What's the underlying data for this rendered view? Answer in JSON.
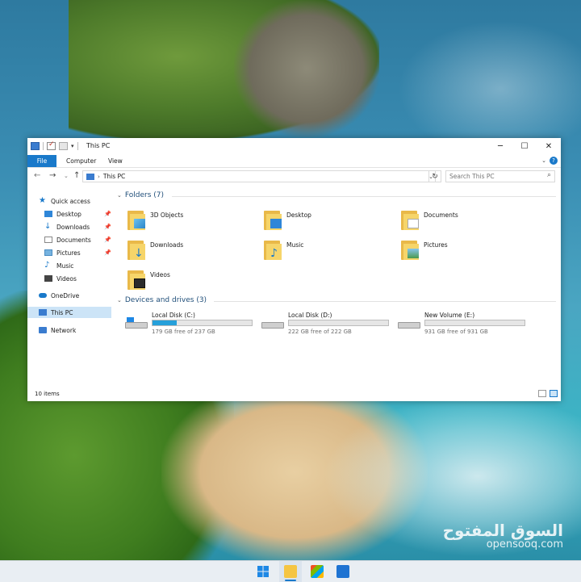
{
  "window": {
    "title": "This PC",
    "ribbon_tabs": [
      "File",
      "Computer",
      "View"
    ],
    "address_path": "This PC",
    "search_placeholder": "Search This PC"
  },
  "sidebar": {
    "items": [
      {
        "label": "Quick access",
        "icon": "star-icon"
      },
      {
        "label": "Desktop",
        "icon": "desktop-icon",
        "pinned": true
      },
      {
        "label": "Downloads",
        "icon": "download-icon",
        "pinned": true
      },
      {
        "label": "Documents",
        "icon": "documents-icon",
        "pinned": true
      },
      {
        "label": "Pictures",
        "icon": "pictures-icon",
        "pinned": true
      },
      {
        "label": "Music",
        "icon": "music-icon"
      },
      {
        "label": "Videos",
        "icon": "videos-icon"
      },
      {
        "label": "OneDrive",
        "icon": "cloud-icon"
      },
      {
        "label": "This PC",
        "icon": "computer-icon",
        "selected": true
      },
      {
        "label": "Network",
        "icon": "network-icon"
      }
    ]
  },
  "folders_section": {
    "title": "Folders (7)",
    "items": [
      {
        "label": "3D Objects",
        "icon": "3d-objects-folder-icon"
      },
      {
        "label": "Desktop",
        "icon": "desktop-folder-icon"
      },
      {
        "label": "Documents",
        "icon": "documents-folder-icon"
      },
      {
        "label": "Downloads",
        "icon": "downloads-folder-icon"
      },
      {
        "label": "Music",
        "icon": "music-folder-icon"
      },
      {
        "label": "Pictures",
        "icon": "pictures-folder-icon"
      },
      {
        "label": "Videos",
        "icon": "videos-folder-icon"
      }
    ]
  },
  "drives_section": {
    "title": "Devices and drives (3)",
    "drives": [
      {
        "name": "Local Disk (C:)",
        "free_text": "179 GB free of 237 GB",
        "used_fraction": 0.245,
        "icon": "windows-drive-icon"
      },
      {
        "name": "Local Disk (D:)",
        "free_text": "222 GB free of 222 GB",
        "used_fraction": 0.0,
        "icon": "drive-icon"
      },
      {
        "name": "New Volume (E:)",
        "free_text": "931 GB free of 931 GB",
        "used_fraction": 0.0,
        "icon": "drive-icon"
      }
    ]
  },
  "status": {
    "item_count": "10 items"
  },
  "watermark": {
    "arabic": "السوق المفتوح",
    "latin": "opensooq.com"
  },
  "colors": {
    "accent": "#1979ca",
    "drive_bar": "#26a0da",
    "selection": "#cce4f7"
  }
}
